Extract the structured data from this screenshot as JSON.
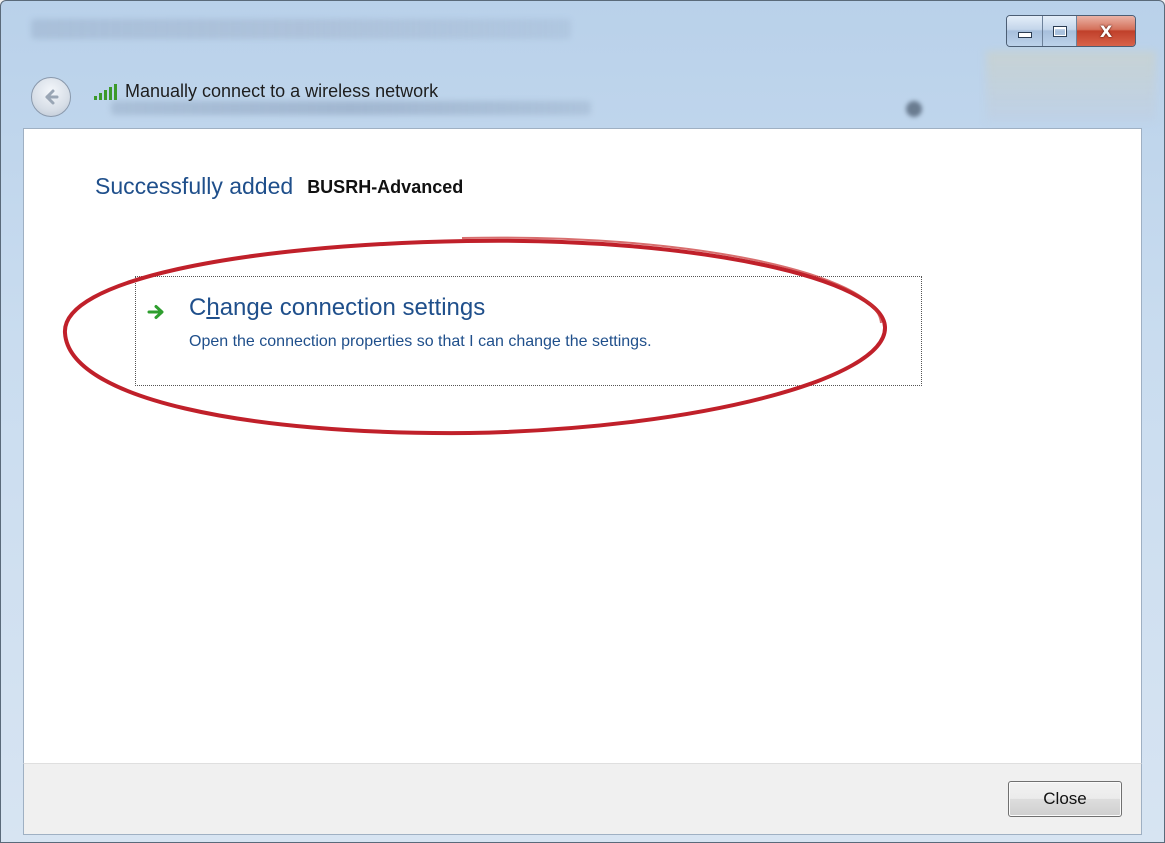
{
  "window": {
    "title": "Manually connect to a wireless network",
    "caption_buttons": {
      "close_glyph": "X"
    }
  },
  "content": {
    "heading": "Successfully added",
    "network_name": "BUSRH-Advanced",
    "command_link": {
      "title_prefix": "C",
      "title_access_key": "h",
      "title_suffix": "ange connection settings",
      "description": "Open the connection properties so that I can change the settings.",
      "icon": "green-arrow-icon"
    }
  },
  "footer": {
    "close_label": "Close"
  },
  "colors": {
    "link_blue": "#1f4f8b",
    "annotation_red": "#c0202a",
    "arrow_green": "#2e9e2e"
  },
  "icons": {
    "back": "back-arrow-icon",
    "signal": "wireless-signal-icon"
  }
}
